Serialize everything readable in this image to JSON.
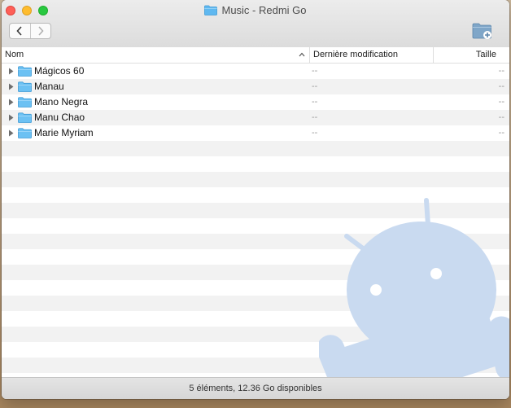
{
  "window": {
    "title": "Music - Redmi Go"
  },
  "toolbar": {
    "back_icon": "chevron-left-icon",
    "forward_icon": "chevron-right-icon",
    "new_folder_icon": "new-folder-icon"
  },
  "columns": {
    "name": "Nom",
    "modified": "Dernière modification",
    "size": "Taille"
  },
  "files": [
    {
      "name": "Mágicos 60",
      "modified": "--",
      "size": "--"
    },
    {
      "name": "Manau",
      "modified": "--",
      "size": "--"
    },
    {
      "name": "Mano Negra",
      "modified": "--",
      "size": "--"
    },
    {
      "name": "Manu Chao",
      "modified": "--",
      "size": "--"
    },
    {
      "name": "Marie Myriam",
      "modified": "--",
      "size": "--"
    }
  ],
  "status": {
    "text": "5 éléments, 12.36 Go disponibles"
  },
  "colors": {
    "folder": "#5fb8f0",
    "watermark": "#c9daf0"
  }
}
